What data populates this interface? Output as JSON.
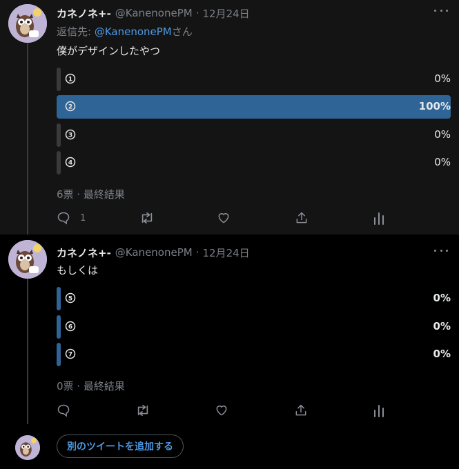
{
  "tweets": [
    {
      "author_name": "カネノネ+-",
      "handle": "@KanenonePM",
      "separator": "·",
      "date": "12月24日",
      "reply_prefix": "返信先: ",
      "reply_mention": "@KanenonePM",
      "reply_suffix": "さん",
      "text": "僕がデザインしたやつ",
      "poll": {
        "options": [
          {
            "label_icon": "circled-1",
            "percent": "0%",
            "fraction": 0.0
          },
          {
            "label_icon": "circled-2",
            "percent": "100%",
            "fraction": 1.0
          },
          {
            "label_icon": "circled-3",
            "percent": "0%",
            "fraction": 0.0
          },
          {
            "label_icon": "circled-4",
            "percent": "0%",
            "fraction": 0.0
          }
        ],
        "meta": "6票 · 最終結果"
      },
      "actions": {
        "reply_count": "1",
        "retweet_count": "",
        "like_count": ""
      }
    },
    {
      "author_name": "カネノネ+-",
      "handle": "@KanenonePM",
      "separator": "·",
      "date": "12月24日",
      "text": "もしくは",
      "poll": {
        "options": [
          {
            "label_icon": "circled-5",
            "percent": "0%",
            "fraction": 0.0
          },
          {
            "label_icon": "circled-6",
            "percent": "0%",
            "fraction": 0.0
          },
          {
            "label_icon": "circled-7",
            "percent": "0%",
            "fraction": 0.0
          }
        ],
        "meta": "0票 · 最終結果"
      },
      "actions": {
        "reply_count": "",
        "retweet_count": "",
        "like_count": ""
      }
    }
  ],
  "add_tweet_label": "別のツイートを追加する",
  "colors": {
    "accent": "#4d9be6",
    "poll_winner": "#2f6496",
    "poll_bar": "#3a3a3a",
    "poll_bar_active": "#2f6496"
  }
}
